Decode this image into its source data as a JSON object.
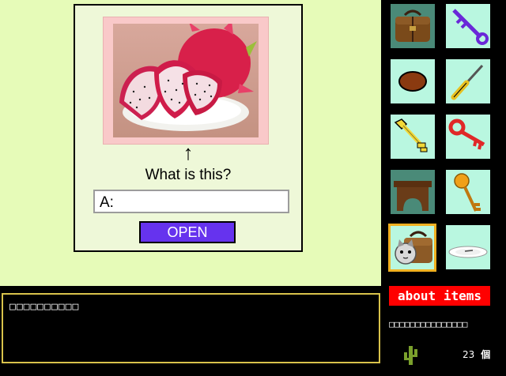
{
  "puzzle": {
    "arrow": "↑",
    "question": "What is this?",
    "answer_value": "A:",
    "open_label": "OPEN"
  },
  "message_text": "□□□□□□□□□□",
  "inventory": {
    "items": [
      {
        "icon": "bag-icon"
      },
      {
        "icon": "purple-key-icon"
      },
      {
        "icon": "oval-stone-icon"
      },
      {
        "icon": "screwdriver-icon"
      },
      {
        "icon": "yellow-key-icon"
      },
      {
        "icon": "red-key-icon"
      },
      {
        "icon": "wooden-stool-icon"
      },
      {
        "icon": "round-key-icon"
      },
      {
        "icon": "cat-in-bag-icon",
        "selected": true
      },
      {
        "icon": "white-plate-icon"
      }
    ],
    "about_label": "about items",
    "item_description": "□□□□□□□□□□□□□□□",
    "count_value": "23",
    "count_unit": "個"
  },
  "colors": {
    "stage_bg": "#e6fbb8",
    "slot_bg": "#b9f7e0",
    "open_button": "#6633ee",
    "about_button": "#ff0000",
    "selected_border": "#f0b020"
  }
}
